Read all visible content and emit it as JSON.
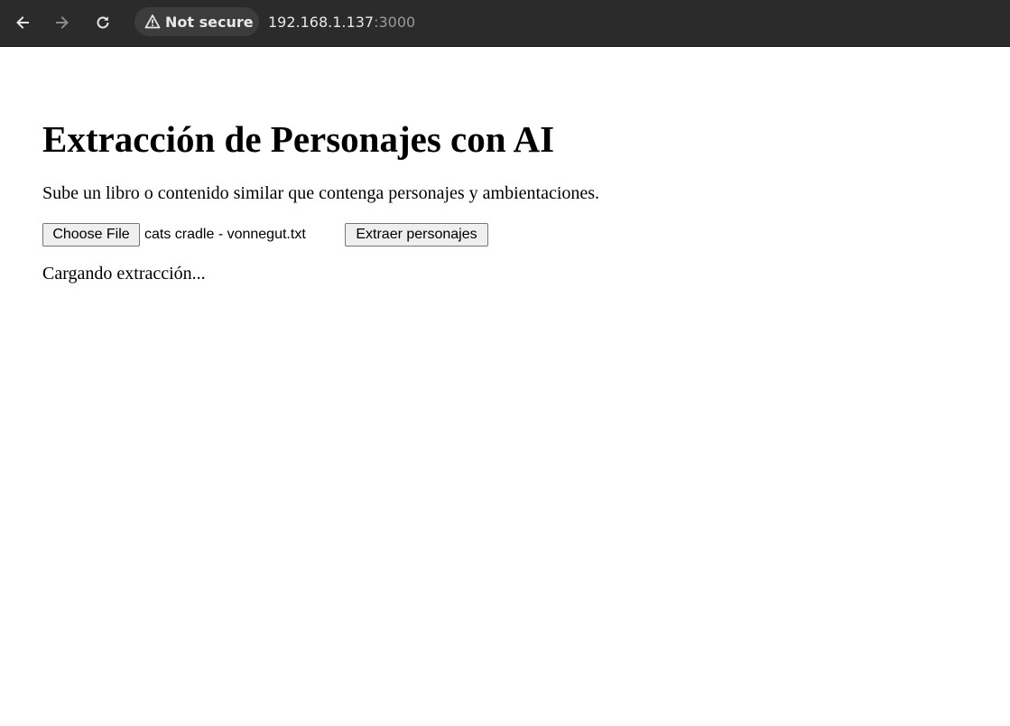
{
  "browser": {
    "security_label": "Not secure",
    "url_host": "192.168.1.137",
    "url_port": ":3000",
    "icons": {
      "back": "arrow-left-icon",
      "forward": "arrow-right-icon",
      "reload": "reload-icon",
      "security": "warning-triangle-icon"
    }
  },
  "page": {
    "title": "Extracción de Personajes con AI",
    "subtitle": "Sube un libro o contenido similar que contenga personajes y ambientaciones.",
    "file_button_label": "Choose File",
    "file_name": "cats cradle - vonnegut.txt",
    "extract_button_label": "Extraer personajes",
    "status": "Cargando extracción..."
  }
}
